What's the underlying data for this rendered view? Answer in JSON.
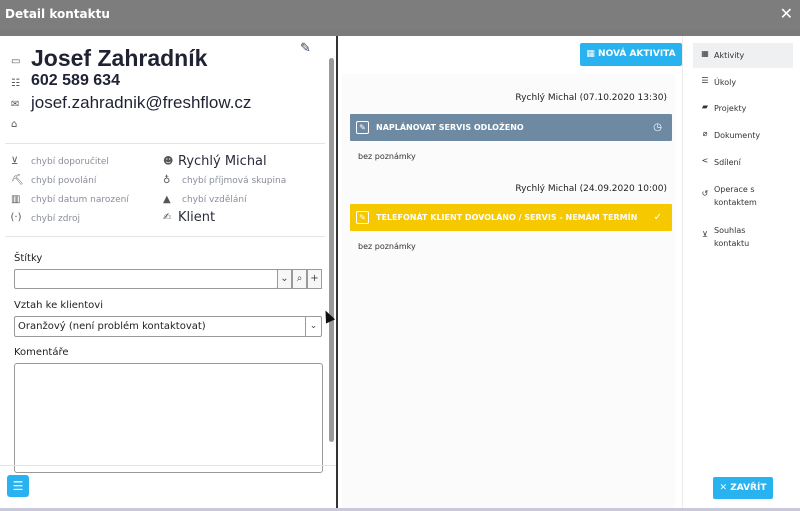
{
  "window": {
    "title": "Detail kontaktu",
    "close_glyph": "✕"
  },
  "contact": {
    "name": "Josef Zahradník",
    "phone": "602 589 634",
    "email": "josef.zahradnik@freshflow.cz"
  },
  "attributes": {
    "left": [
      {
        "icon": "handshake-icon",
        "glyph": "🤝",
        "text": "chybí doporučitel"
      },
      {
        "icon": "worker-icon",
        "glyph": "⛏",
        "text": "chybí povolání"
      },
      {
        "icon": "cake-icon",
        "glyph": "🎂",
        "text": "chybí datum narození"
      },
      {
        "icon": "broadcast-icon",
        "glyph": "(·)",
        "text": "chybí zdroj"
      }
    ],
    "right": [
      {
        "icon": "user-icon",
        "glyph": "👤",
        "text": "Rychlý Michal",
        "dark": true
      },
      {
        "icon": "money-bag-icon",
        "glyph": "💰",
        "text": "chybí příjmová skupina",
        "dark": false
      },
      {
        "icon": "graduation-cap-icon",
        "glyph": "🎓",
        "text": "chybí vzdělání",
        "dark": false
      },
      {
        "icon": "signature-icon",
        "glyph": "✍",
        "text": "Klient",
        "dark": true
      }
    ]
  },
  "form": {
    "tags_label": "Štítky",
    "tags_value": "",
    "relation_label": "Vztah ke klientovi",
    "relation_value": "Oranžový (není problém kontaktovat)",
    "comments_label": "Komentáře"
  },
  "activities": {
    "new_button": "NOVÁ AKTIVITA",
    "items": [
      {
        "meta": "Rychlý Michal (07.10.2020 13:30)",
        "title": "NAPLÁNOVAT SERVIS ODLOŽENO",
        "color": "#6e8aa3",
        "right_icon": "clock-icon",
        "right_glyph": "◷",
        "note": "bez poznámky"
      },
      {
        "meta": "Rychlý Michal (24.09.2020 10:00)",
        "title": "TELEFONÁT KLIENT DOVOLÁNO / SERVIS - NEMÁM TERMÍN",
        "color": "#f5c800",
        "right_icon": "thumbs-up-icon",
        "right_glyph": "👍",
        "note": "bez poznámky"
      }
    ]
  },
  "nav": [
    {
      "icon": "calendar-icon",
      "glyph": "▦",
      "label": "Aktivity",
      "active": true
    },
    {
      "icon": "checklist-icon",
      "glyph": "☰",
      "label": "Úkoly",
      "active": false
    },
    {
      "icon": "folder-icon",
      "glyph": "▰",
      "label": "Projekty",
      "active": false
    },
    {
      "icon": "paperclip-icon",
      "glyph": "⌀",
      "label": "Dokumenty",
      "active": false
    },
    {
      "icon": "share-icon",
      "glyph": "<",
      "label": "Sdílení",
      "active": false
    },
    {
      "icon": "history-icon",
      "glyph": "↺",
      "label": "Operace s kontaktem",
      "active": false
    },
    {
      "icon": "handshake-icon",
      "glyph": "🤝",
      "label": "Souhlas kontaktu",
      "active": false
    }
  ],
  "footer": {
    "close_button": "ZAVŘÍT",
    "close_glyph": "✕",
    "menu_glyph": "☰"
  }
}
